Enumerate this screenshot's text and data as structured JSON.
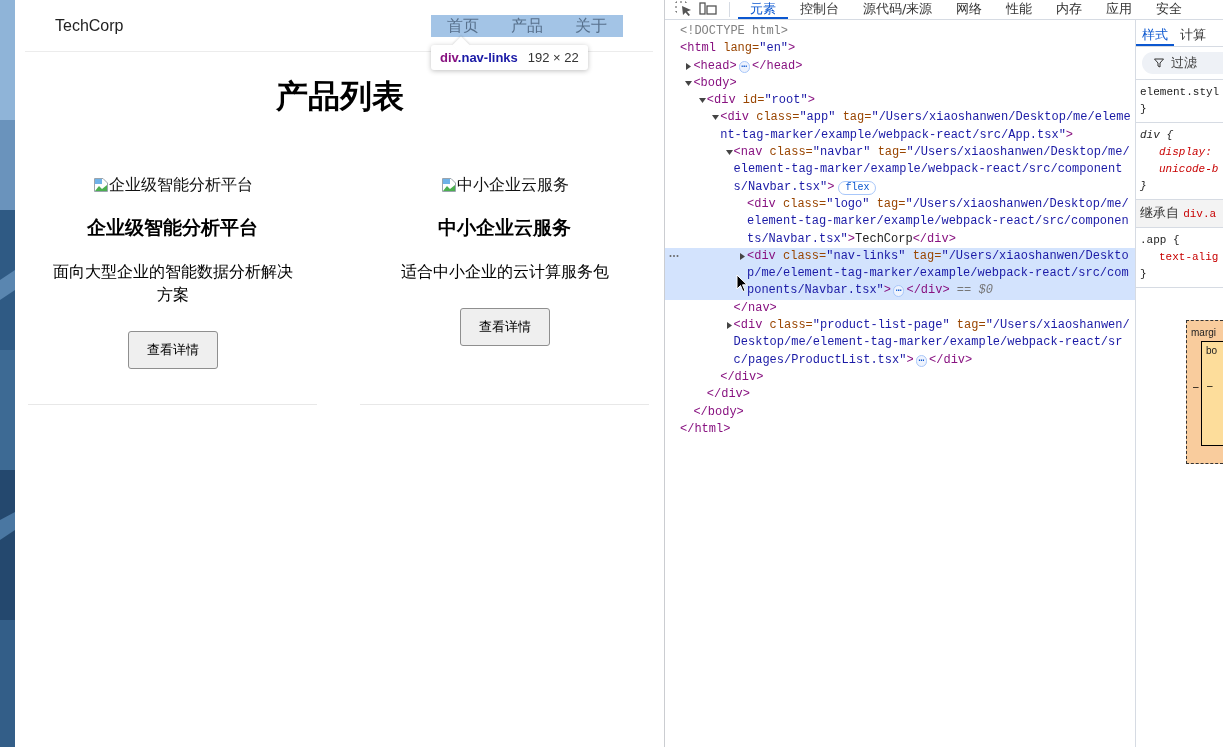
{
  "page": {
    "navbar": {
      "logo": "TechCorp",
      "highlighted": true,
      "links": [
        {
          "label": "首页"
        },
        {
          "label": "产品"
        },
        {
          "label": "关于"
        }
      ]
    },
    "inspect_tooltip": {
      "tag": "div",
      "classes": ".nav-links",
      "size": "192 × 22"
    },
    "title": "产品列表",
    "products": [
      {
        "image_alt": "企业级智能分析平台",
        "name": "企业级智能分析平台",
        "description": "面向大型企业的智能数据分析解决方案",
        "button": "查看详情"
      },
      {
        "image_alt": "中小企业云服务",
        "name": "中小企业云服务",
        "description": "适合中小企业的云计算服务包",
        "button": "查看详情"
      }
    ]
  },
  "devtools": {
    "tabs": [
      {
        "label": "元素",
        "selected": true
      },
      {
        "label": "控制台",
        "selected": false
      },
      {
        "label": "源代码/来源",
        "selected": false
      },
      {
        "label": "网络",
        "selected": false
      },
      {
        "label": "性能",
        "selected": false
      },
      {
        "label": "内存",
        "selected": false
      },
      {
        "label": "应用",
        "selected": false
      },
      {
        "label": "安全",
        "selected": false
      }
    ],
    "dom_tree": [
      {
        "selected": false,
        "open": [
          {
            "kind": "doctype",
            "text": "<!DOCTYPE html>"
          }
        ]
      },
      {
        "selected": false,
        "open": [
          {
            "kind": "tag",
            "text": "<html"
          },
          {
            "kind": "attr",
            "text": " lang="
          },
          {
            "kind": "value",
            "text": "\"en\""
          },
          {
            "kind": "tag",
            "text": ">"
          }
        ],
        "close": [
          {
            "kind": "tag",
            "text": "</html>"
          }
        ],
        "children": [
          {
            "selected": false,
            "expanded": false,
            "open": [
              {
                "kind": "tag",
                "text": "<head>"
              },
              {
                "kind": "pill",
                "text": "⋯"
              },
              {
                "kind": "tag",
                "text": "</head>"
              }
            ]
          },
          {
            "selected": false,
            "expanded": true,
            "open": [
              {
                "kind": "tag",
                "text": "<body>"
              }
            ],
            "close": [
              {
                "kind": "tag",
                "text": "</body>"
              }
            ],
            "children": [
              {
                "selected": false,
                "expanded": true,
                "open": [
                  {
                    "kind": "tag",
                    "text": "<div"
                  },
                  {
                    "kind": "attr",
                    "text": " id="
                  },
                  {
                    "kind": "value",
                    "text": "\"root\""
                  },
                  {
                    "kind": "tag",
                    "text": ">"
                  }
                ],
                "close": [
                  {
                    "kind": "tag",
                    "text": "</div>"
                  }
                ],
                "children": [
                  {
                    "selected": false,
                    "expanded": true,
                    "open": [
                      {
                        "kind": "tag",
                        "text": "<div"
                      },
                      {
                        "kind": "attr",
                        "text": " class="
                      },
                      {
                        "kind": "value",
                        "text": "\"app\""
                      },
                      {
                        "kind": "attr",
                        "text": " tag="
                      },
                      {
                        "kind": "value",
                        "text": "\"/Users/xiaoshanwen/Desktop/me/element-tag-marker/example/webpack-react/src/App.tsx\""
                      },
                      {
                        "kind": "tag",
                        "text": ">"
                      }
                    ],
                    "close": [
                      {
                        "kind": "tag",
                        "text": "</div>"
                      }
                    ],
                    "children": [
                      {
                        "selected": false,
                        "expanded": true,
                        "open": [
                          {
                            "kind": "tag",
                            "text": "<nav"
                          },
                          {
                            "kind": "attr",
                            "text": " class="
                          },
                          {
                            "kind": "value",
                            "text": "\"navbar\""
                          },
                          {
                            "kind": "attr",
                            "text": " tag="
                          },
                          {
                            "kind": "value",
                            "text": "\"/Users/xiaoshanwen/Desktop/me/element-tag-marker/example/webpack-react/src/components/Navbar.tsx\""
                          },
                          {
                            "kind": "tag",
                            "text": ">"
                          },
                          {
                            "kind": "badge",
                            "text": "flex"
                          }
                        ],
                        "close": [
                          {
                            "kind": "tag",
                            "text": "</nav>"
                          }
                        ],
                        "children": [
                          {
                            "selected": false,
                            "open": [
                              {
                                "kind": "tag",
                                "text": "<div"
                              },
                              {
                                "kind": "attr",
                                "text": " class="
                              },
                              {
                                "kind": "value",
                                "text": "\"logo\""
                              },
                              {
                                "kind": "attr",
                                "text": " tag="
                              },
                              {
                                "kind": "value",
                                "text": "\"/Users/xiaoshanwen/Desktop/me/element-tag-marker/example/webpack-react/src/components/Navbar.tsx\""
                              },
                              {
                                "kind": "tag",
                                "text": ">"
                              },
                              {
                                "kind": "text",
                                "text": "TechCorp"
                              },
                              {
                                "kind": "tag",
                                "text": "</div>"
                              }
                            ]
                          },
                          {
                            "selected": true,
                            "expanded": false,
                            "open": [
                              {
                                "kind": "tag",
                                "text": "<div"
                              },
                              {
                                "kind": "attr",
                                "text": " class="
                              },
                              {
                                "kind": "value",
                                "text": "\"nav-links\""
                              },
                              {
                                "kind": "attr",
                                "text": " tag="
                              },
                              {
                                "kind": "value",
                                "text": "\"/Users/xiaoshanwen/Desktop/me/element-tag-marker/example/webpack-react/src/components/Navbar.tsx\""
                              },
                              {
                                "kind": "tag",
                                "text": ">"
                              },
                              {
                                "kind": "pill",
                                "text": "⋯"
                              },
                              {
                                "kind": "tag",
                                "text": "</div>"
                              },
                              {
                                "kind": "marker",
                                "text": " == $0"
                              }
                            ]
                          }
                        ]
                      },
                      {
                        "selected": false,
                        "expanded": false,
                        "open": [
                          {
                            "kind": "tag",
                            "text": "<div"
                          },
                          {
                            "kind": "attr",
                            "text": " class="
                          },
                          {
                            "kind": "value",
                            "text": "\"product-list-page\""
                          },
                          {
                            "kind": "attr",
                            "text": " tag="
                          },
                          {
                            "kind": "value",
                            "text": "\"/Users/xiaoshanwen/Desktop/me/element-tag-marker/example/webpack-react/src/pages/ProductList.tsx\""
                          },
                          {
                            "kind": "tag",
                            "text": ">"
                          },
                          {
                            "kind": "pill",
                            "text": "⋯"
                          },
                          {
                            "kind": "tag",
                            "text": "</div>"
                          }
                        ]
                      }
                    ]
                  }
                ]
              }
            ]
          }
        ]
      }
    ],
    "styles": {
      "tabs": [
        {
          "label": "样式",
          "selected": true
        },
        {
          "label": "计算",
          "selected": false
        }
      ],
      "filter_placeholder": "过滤",
      "sections": [
        {
          "user_agent": false,
          "lines": [
            {
              "kind": "selector",
              "text": "element.styl"
            },
            {
              "kind": "brace",
              "text": "}"
            }
          ]
        },
        {
          "user_agent": true,
          "lines": [
            {
              "kind": "selector",
              "text": "div {"
            },
            {
              "kind": "property",
              "text": "display:"
            },
            {
              "kind": "property",
              "text": "unicode-b"
            },
            {
              "kind": "brace",
              "text": "}"
            }
          ]
        },
        {
          "user_agent": false,
          "lines": [
            {
              "kind": "inherited",
              "label": "继承自",
              "source": "div.a"
            }
          ]
        },
        {
          "user_agent": false,
          "lines": [
            {
              "kind": "selector",
              "text": ".app {"
            },
            {
              "kind": "property",
              "text": "text-alig"
            },
            {
              "kind": "brace",
              "text": "}"
            }
          ]
        }
      ],
      "box_model": {
        "margin_label": "margi",
        "margin_value": "–",
        "border_label": "bo",
        "border_value": "–"
      }
    }
  }
}
